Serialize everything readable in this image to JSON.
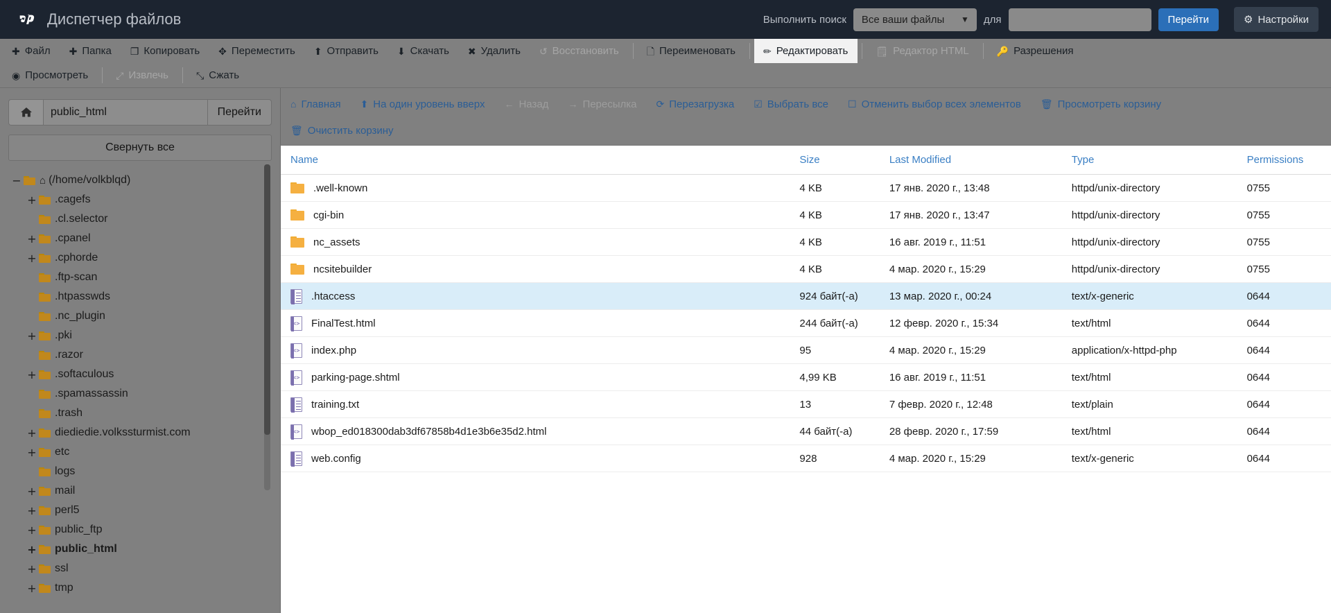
{
  "header": {
    "brand_logo": "cp-logo-icon",
    "title": "Диспетчер файлов",
    "search_label": "Выполнить поиск",
    "search_scope_selected": "Все ваши файлы",
    "search_scope_options": [
      "Все ваши файлы"
    ],
    "search_for_label": "для",
    "search_value": "",
    "search_placeholder": "",
    "go_button": "Перейти",
    "settings_button": "Настройки",
    "bar_color": "#1c2430",
    "primary_color": "#2b6fb8"
  },
  "toolbar": {
    "row1": [
      {
        "label": "Файл",
        "icon": "plus-icon",
        "state": "enabled"
      },
      {
        "label": "Папка",
        "icon": "plus-icon",
        "state": "enabled"
      },
      {
        "label": "Копировать",
        "icon": "copy-icon",
        "state": "enabled"
      },
      {
        "label": "Переместить",
        "icon": "move-icon",
        "state": "enabled"
      },
      {
        "label": "Отправить",
        "icon": "upload-icon",
        "state": "enabled"
      },
      {
        "label": "Скачать",
        "icon": "download-icon",
        "state": "enabled"
      },
      {
        "label": "Удалить",
        "icon": "close-x-icon",
        "state": "enabled"
      },
      {
        "label": "Восстановить",
        "icon": "undo-icon",
        "state": "disabled"
      },
      {
        "label": "Переименовать",
        "icon": "file-icon",
        "state": "enabled"
      },
      {
        "label": "Редактировать",
        "icon": "pencil-icon",
        "state": "active"
      },
      {
        "label": "Редактор HTML",
        "icon": "html-edit-icon",
        "state": "disabled"
      },
      {
        "label": "Разрешения",
        "icon": "key-icon",
        "state": "enabled"
      }
    ],
    "row2": [
      {
        "label": "Просмотреть",
        "icon": "eye-icon",
        "state": "enabled"
      },
      {
        "label": "Извлечь",
        "icon": "expand-icon",
        "state": "disabled"
      },
      {
        "label": "Сжать",
        "icon": "compress-icon",
        "state": "enabled"
      }
    ]
  },
  "sidebar": {
    "home_icon": "home-icon",
    "path_value": "public_html",
    "path_placeholder": "",
    "goto_button": "Перейти",
    "collapse_button": "Свернуть все",
    "tree": [
      {
        "label": "(/home/volkblqd)",
        "expander": "−",
        "depth": 0,
        "icon": "folder-open-home-icon",
        "bold": false
      },
      {
        "label": ".cagefs",
        "expander": "+",
        "depth": 1,
        "icon": "folder-icon",
        "bold": false
      },
      {
        "label": ".cl.selector",
        "expander": "",
        "depth": 1,
        "icon": "folder-icon",
        "bold": false
      },
      {
        "label": ".cpanel",
        "expander": "+",
        "depth": 1,
        "icon": "folder-icon",
        "bold": false
      },
      {
        "label": ".cphorde",
        "expander": "+",
        "depth": 1,
        "icon": "folder-icon",
        "bold": false
      },
      {
        "label": ".ftp-scan",
        "expander": "",
        "depth": 1,
        "icon": "folder-icon",
        "bold": false
      },
      {
        "label": ".htpasswds",
        "expander": "",
        "depth": 1,
        "icon": "folder-icon",
        "bold": false
      },
      {
        "label": ".nc_plugin",
        "expander": "",
        "depth": 1,
        "icon": "folder-icon",
        "bold": false
      },
      {
        "label": ".pki",
        "expander": "+",
        "depth": 1,
        "icon": "folder-icon",
        "bold": false
      },
      {
        "label": ".razor",
        "expander": "",
        "depth": 1,
        "icon": "folder-icon",
        "bold": false
      },
      {
        "label": ".softaculous",
        "expander": "+",
        "depth": 1,
        "icon": "folder-icon",
        "bold": false
      },
      {
        "label": ".spamassassin",
        "expander": "",
        "depth": 1,
        "icon": "folder-icon",
        "bold": false
      },
      {
        "label": ".trash",
        "expander": "",
        "depth": 1,
        "icon": "folder-icon",
        "bold": false
      },
      {
        "label": "diediedie.volkssturmist.com",
        "expander": "+",
        "depth": 1,
        "icon": "folder-icon",
        "bold": false
      },
      {
        "label": "etc",
        "expander": "+",
        "depth": 1,
        "icon": "folder-icon",
        "bold": false
      },
      {
        "label": "logs",
        "expander": "",
        "depth": 1,
        "icon": "folder-icon",
        "bold": false
      },
      {
        "label": "mail",
        "expander": "+",
        "depth": 1,
        "icon": "folder-icon",
        "bold": false
      },
      {
        "label": "perl5",
        "expander": "+",
        "depth": 1,
        "icon": "folder-icon",
        "bold": false
      },
      {
        "label": "public_ftp",
        "expander": "+",
        "depth": 1,
        "icon": "folder-icon",
        "bold": false
      },
      {
        "label": "public_html",
        "expander": "+",
        "depth": 1,
        "icon": "folder-icon",
        "bold": true
      },
      {
        "label": "ssl",
        "expander": "+",
        "depth": 1,
        "icon": "folder-icon",
        "bold": false
      },
      {
        "label": "tmp",
        "expander": "+",
        "depth": 1,
        "icon": "folder-icon",
        "bold": false
      }
    ]
  },
  "nav": {
    "row1": [
      {
        "label": "Главная",
        "icon": "home-icon",
        "state": "enabled"
      },
      {
        "label": "На один уровень вверх",
        "icon": "arrow-up-icon",
        "state": "enabled"
      },
      {
        "label": "Назад",
        "icon": "arrow-left-icon",
        "state": "disabled"
      },
      {
        "label": "Пересылка",
        "icon": "arrow-right-icon",
        "state": "disabled"
      },
      {
        "label": "Перезагрузка",
        "icon": "refresh-icon",
        "state": "enabled"
      },
      {
        "label": "Выбрать все",
        "icon": "checkbox-checked-icon",
        "state": "enabled"
      },
      {
        "label": "Отменить выбор всех элементов",
        "icon": "checkbox-empty-icon",
        "state": "enabled"
      },
      {
        "label": "Просмотреть корзину",
        "icon": "trash-icon",
        "state": "enabled"
      }
    ],
    "row2": [
      {
        "label": "Очистить корзину",
        "icon": "trash-icon",
        "state": "enabled"
      }
    ]
  },
  "table": {
    "columns": [
      {
        "key": "name",
        "label": "Name"
      },
      {
        "key": "size",
        "label": "Size"
      },
      {
        "key": "modified",
        "label": "Last Modified"
      },
      {
        "key": "type",
        "label": "Type"
      },
      {
        "key": "permissions",
        "label": "Permissions"
      }
    ],
    "rows": [
      {
        "icon": "folder-icon",
        "name": ".well-known",
        "size": "4 KB",
        "modified": "17 янв. 2020 г., 13:48",
        "type": "httpd/unix-directory",
        "permissions": "0755",
        "selected": false
      },
      {
        "icon": "folder-icon",
        "name": "cgi-bin",
        "size": "4 KB",
        "modified": "17 янв. 2020 г., 13:47",
        "type": "httpd/unix-directory",
        "permissions": "0755",
        "selected": false
      },
      {
        "icon": "folder-icon",
        "name": "nc_assets",
        "size": "4 KB",
        "modified": "16 авг. 2019 г., 11:51",
        "type": "httpd/unix-directory",
        "permissions": "0755",
        "selected": false
      },
      {
        "icon": "folder-icon",
        "name": "ncsitebuilder",
        "size": "4 KB",
        "modified": "4 мар. 2020 г., 15:29",
        "type": "httpd/unix-directory",
        "permissions": "0755",
        "selected": false
      },
      {
        "icon": "text-file-icon",
        "name": ".htaccess",
        "size": "924 байт(-а)",
        "modified": "13 мар. 2020 г., 00:24",
        "type": "text/x-generic",
        "permissions": "0644",
        "selected": true
      },
      {
        "icon": "html-file-icon",
        "name": "FinalTest.html",
        "size": "244 байт(-а)",
        "modified": "12 февр. 2020 г., 15:34",
        "type": "text/html",
        "permissions": "0644",
        "selected": false
      },
      {
        "icon": "html-file-icon",
        "name": "index.php",
        "size": "95",
        "modified": "4 мар. 2020 г., 15:29",
        "type": "application/x-httpd-php",
        "permissions": "0644",
        "selected": false
      },
      {
        "icon": "html-file-icon",
        "name": "parking-page.shtml",
        "size": "4,99 KB",
        "modified": "16 авг. 2019 г., 11:51",
        "type": "text/html",
        "permissions": "0644",
        "selected": false
      },
      {
        "icon": "text-file-icon",
        "name": "training.txt",
        "size": "13",
        "modified": "7 февр. 2020 г., 12:48",
        "type": "text/plain",
        "permissions": "0644",
        "selected": false
      },
      {
        "icon": "html-file-icon",
        "name": "wbop_ed018300dab3df67858b4d1e3b6e35d2.html",
        "size": "44 байт(-а)",
        "modified": "28 февр. 2020 г., 17:59",
        "type": "text/html",
        "permissions": "0644",
        "selected": false
      },
      {
        "icon": "text-file-icon",
        "name": "web.config",
        "size": "928",
        "modified": "4 мар. 2020 г., 15:29",
        "type": "text/x-generic",
        "permissions": "0644",
        "selected": false
      }
    ]
  }
}
